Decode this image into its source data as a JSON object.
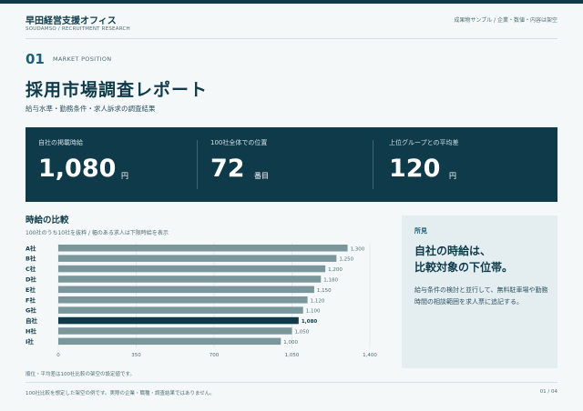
{
  "header": {
    "brand": "早田経営支援オフィス",
    "brand_sub": "SOUDAMSO  /  RECRUITMENT RESEARCH",
    "note": "成果物サンプル / 企業・数値・内容は架空"
  },
  "section": {
    "number": "01",
    "label": "MARKET POSITION",
    "title": "採用市場調査レポート",
    "subtitle": "給与水準・勤務条件・求人訴求の調査結果"
  },
  "kpis": [
    {
      "label": "自社の掲載時給",
      "value": "1,080",
      "unit": "円"
    },
    {
      "label": "100社全体での位置",
      "value": "72",
      "unit": "番目"
    },
    {
      "label": "上位グループとの平均差",
      "value": "120",
      "unit": "円"
    }
  ],
  "chart_section": {
    "title": "時給の比較",
    "subtitle": "100社のうち10社を抜粋 / 幅のある求人は下限時給を表示",
    "note": "順位・平均差は100社比較の架空の設定値です。"
  },
  "chart_data": {
    "type": "bar",
    "orientation": "horizontal",
    "categories": [
      "A社",
      "B社",
      "C社",
      "D社",
      "E社",
      "F社",
      "G社",
      "自社",
      "H社",
      "I社"
    ],
    "values": [
      1300,
      1250,
      1200,
      1180,
      1150,
      1120,
      1100,
      1080,
      1050,
      1000
    ],
    "value_labels": [
      "1,300",
      "1,250",
      "1,200",
      "1,180",
      "1,150",
      "1,120",
      "1,100",
      "1,080",
      "1,050",
      "1,000"
    ],
    "highlight": "自社",
    "xlim": [
      0,
      1400
    ],
    "xticks": [
      "0",
      "350",
      "700",
      "1,050",
      "1,400"
    ],
    "xtick_values": [
      0,
      350,
      700,
      1050,
      1400
    ],
    "grid": true,
    "colors": {
      "bar": "#7b979c",
      "highlight": "#0f3a4a",
      "grid": "#d8e2e4",
      "text": "#0f3a4a",
      "muted": "#4f6e78"
    }
  },
  "insight": {
    "label": "所見",
    "headline": [
      "自社の時給は、",
      "比較対象の下位帯。"
    ],
    "body": "給与条件の検討と並行して、無料駐車場や勤務時間の相談範囲を求人票に追記する。"
  },
  "footer": {
    "note": "100社比較を想定した架空の例です。実際の企業・職種・調査結果ではありません。",
    "page": "01 / 04"
  }
}
